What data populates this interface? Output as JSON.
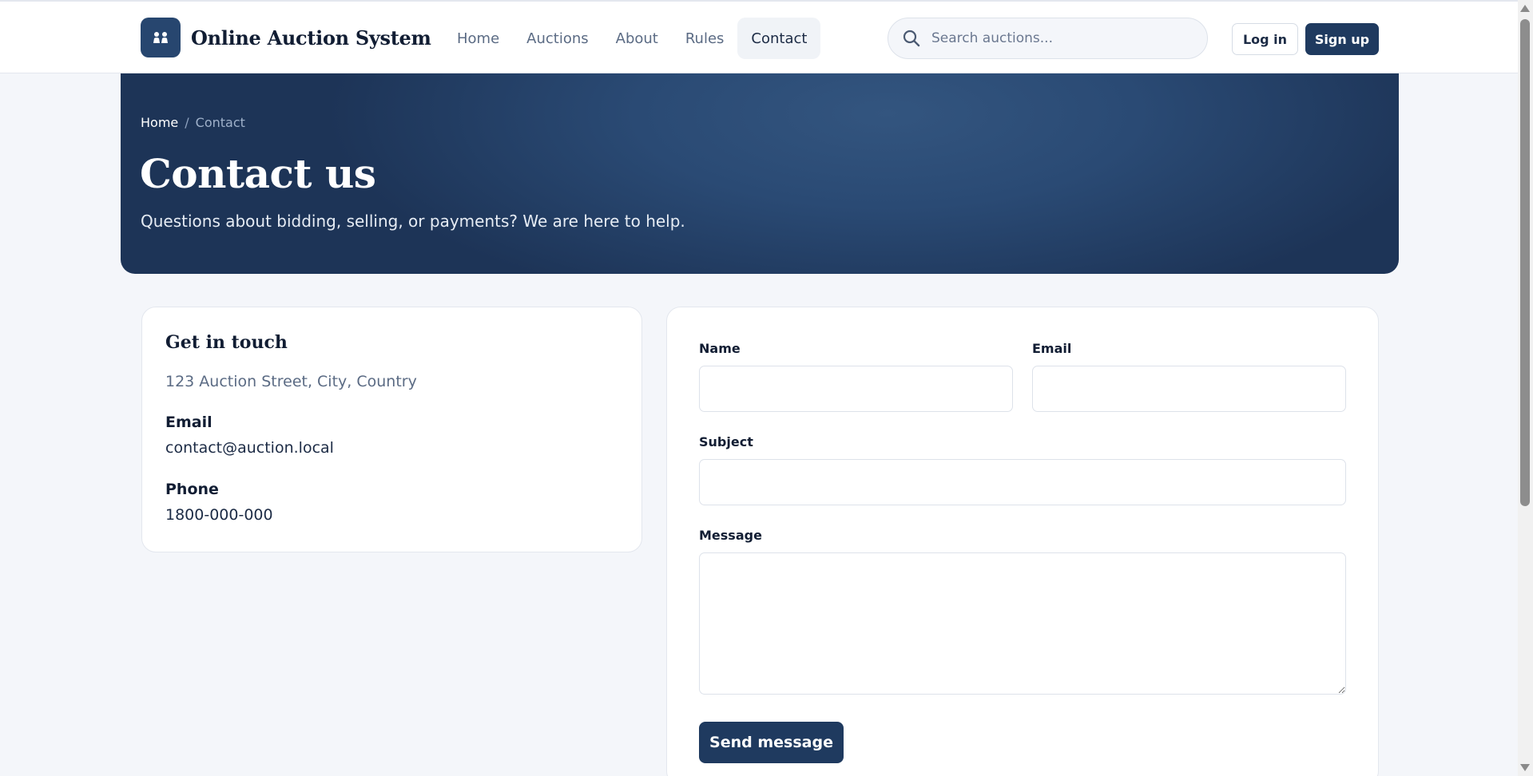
{
  "header": {
    "brand_name": "Online Auction System",
    "brand_icon": "auction-gavel-icon",
    "nav": [
      {
        "label": "Home"
      },
      {
        "label": "Auctions"
      },
      {
        "label": "About"
      },
      {
        "label": "Rules"
      },
      {
        "label": "Contact",
        "active": true
      }
    ],
    "search_placeholder": "Search auctions...",
    "login_label": "Log in",
    "signup_label": "Sign up"
  },
  "hero": {
    "breadcrumb_home": "Home",
    "breadcrumb_sep": "/",
    "breadcrumb_current": "Contact",
    "title": "Contact us",
    "subtitle": "Questions about bidding, selling, or payments? We are here to help."
  },
  "contact_info": {
    "title": "Get in touch",
    "address": "123 Auction Street, City, Country",
    "email_label": "Email",
    "email_value": "contact@auction.local",
    "phone_label": "Phone",
    "phone_value": "1800-000-000"
  },
  "form": {
    "name_label": "Name",
    "name_value": "",
    "email_label": "Email",
    "email_value": "",
    "subject_label": "Subject",
    "subject_value": "",
    "message_label": "Message",
    "message_value": "",
    "submit_label": "Send message"
  },
  "colors": {
    "primary": "#1f3a5f",
    "page_background": "#f4f6fa",
    "hero_gradient": "#2a4a74"
  }
}
